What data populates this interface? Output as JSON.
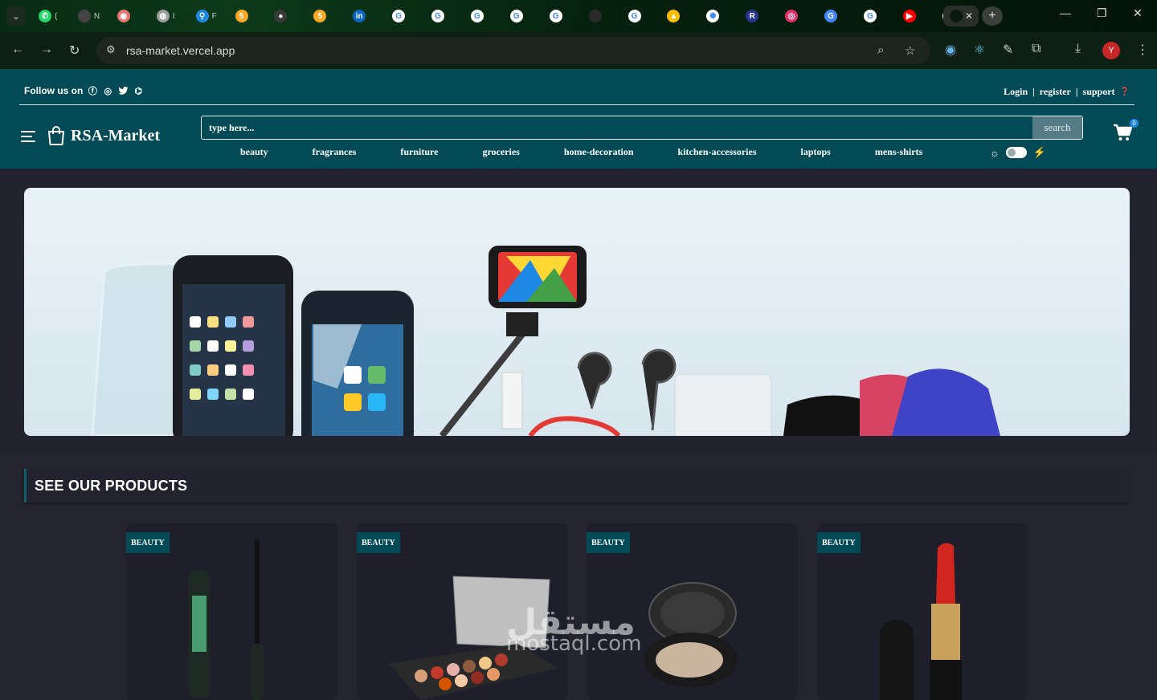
{
  "browser": {
    "url": "rsa-market.vercel.app",
    "tabs": [
      {
        "icon": "whatsapp-icon",
        "color": "#25d366",
        "glyph": "✆",
        "label": "("
      },
      {
        "icon": "gmail-icon",
        "color": "#444",
        "glyph": "",
        "label": "N"
      },
      {
        "icon": "record-icon",
        "color": "#e57373",
        "glyph": "◉",
        "label": ""
      },
      {
        "icon": "globe-icon",
        "color": "#9e9e9e",
        "glyph": "◍",
        "label": "I"
      },
      {
        "icon": "bookmark-icon",
        "color": "#1e88e5",
        "glyph": "⚲",
        "label": "F"
      },
      {
        "icon": "five-icon",
        "color": "#f9a825",
        "glyph": "5",
        "label": ""
      },
      {
        "icon": "dark-dot-icon",
        "color": "#3a3a3a",
        "glyph": "●",
        "label": ""
      },
      {
        "icon": "five-icon",
        "color": "#f9a825",
        "glyph": "5",
        "label": ""
      },
      {
        "icon": "linkedin-icon",
        "color": "#0a66c2",
        "glyph": "in",
        "label": ""
      },
      {
        "icon": "google-icon",
        "color": "#ffffff",
        "glyph": "G",
        "label": ""
      },
      {
        "icon": "google-icon",
        "color": "#ffffff",
        "glyph": "G",
        "label": ""
      },
      {
        "icon": "google-icon",
        "color": "#ffffff",
        "glyph": "G",
        "label": ""
      },
      {
        "icon": "google-icon",
        "color": "#ffffff",
        "glyph": "G",
        "label": ""
      },
      {
        "icon": "google-icon",
        "color": "#ffffff",
        "glyph": "G",
        "label": ""
      },
      {
        "icon": "blank-icon",
        "color": "#2a2a2a",
        "glyph": "",
        "label": ""
      },
      {
        "icon": "google-icon",
        "color": "#ffffff",
        "glyph": "G",
        "label": ""
      },
      {
        "icon": "drive-icon",
        "color": "#fbbc04",
        "glyph": "▲",
        "label": ""
      },
      {
        "icon": "openai-icon",
        "color": "#ffffff",
        "glyph": "✺",
        "label": ""
      },
      {
        "icon": "r-icon",
        "color": "#283593",
        "glyph": "R",
        "label": ""
      },
      {
        "icon": "instagram-icon",
        "color": "#e1306c",
        "glyph": "◎",
        "label": ""
      },
      {
        "icon": "translate-icon",
        "color": "#4285f4",
        "glyph": "G",
        "label": ""
      },
      {
        "icon": "google-icon",
        "color": "#ffffff",
        "glyph": "G",
        "label": ""
      },
      {
        "icon": "youtube-music-icon",
        "color": "#ff0000",
        "glyph": "▶",
        "label": ""
      },
      {
        "icon": "github-icon",
        "color": "#ffffff",
        "glyph": "⌬",
        "label": ""
      }
    ]
  },
  "header": {
    "follow_label": "Follow us on",
    "login": "Login",
    "register": "register",
    "support": "support",
    "separator": "|",
    "brand": "RSA-Market",
    "search_placeholder": "type here...",
    "search_button": "search",
    "cart_count": "0",
    "categories": [
      "beauty",
      "fragrances",
      "furniture",
      "groceries",
      "home-decoration",
      "kitchen-accessories",
      "laptops",
      "mens-shirts"
    ]
  },
  "products": {
    "title": "SEE OUR PRODUCTS",
    "cards": [
      {
        "badge": "BEAUTY",
        "image": "mascara"
      },
      {
        "badge": "BEAUTY",
        "image": "eyeshadow-palette"
      },
      {
        "badge": "BEAUTY",
        "image": "powder-compact"
      },
      {
        "badge": "BEAUTY",
        "image": "red-lipstick"
      }
    ]
  },
  "watermark": {
    "arabic": "مستقل",
    "latin": "mostaql.com"
  }
}
